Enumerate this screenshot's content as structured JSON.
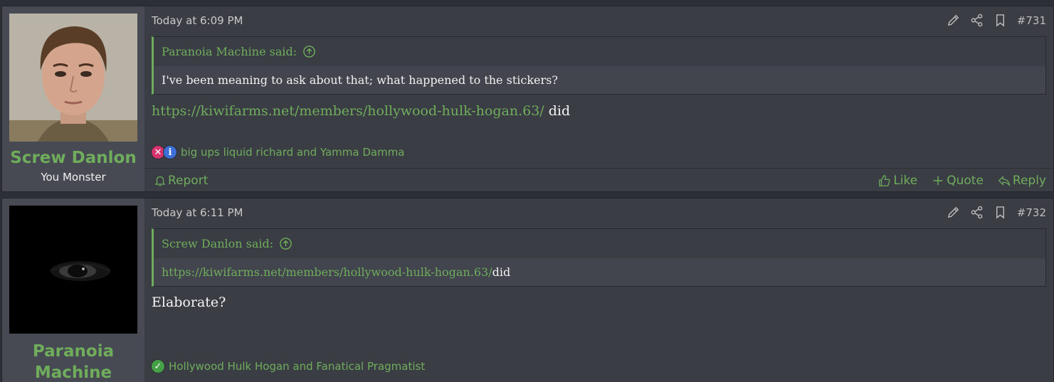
{
  "posts": [
    {
      "username": "Screw Danlon",
      "user_title": "You Monster",
      "avatar_icon": "user-photo-avatar",
      "date": "Today at 6:09 PM",
      "post_number": "#731",
      "quote": {
        "author": "Paranoia Machine said:",
        "text": "I've been meaning to ask about that; what happened to the stickers?"
      },
      "message": {
        "link": "https://kiwifarms.net/members/hollywood-hulk-hogan.63/",
        "suffix": " did"
      },
      "reactions": {
        "icons": [
          "x-reaction-icon",
          "info-reaction-icon"
        ],
        "names": "big ups liquid richard and Yamma Damma"
      },
      "footer": {
        "report": "Report",
        "like": "Like",
        "quote": "Quote",
        "reply": "Reply"
      }
    },
    {
      "username": "Paranoia Machine",
      "avatar_icon": "dark-eye-avatar",
      "date": "Today at 6:11 PM",
      "post_number": "#732",
      "quote": {
        "author": "Screw Danlon said:",
        "link": "https://kiwifarms.net/members/hollywood-hulk-hogan.63/",
        "suffix": " did"
      },
      "message": {
        "text": "Elaborate?"
      },
      "reactions": {
        "icons": [
          "check-reaction-icon"
        ],
        "names": "Hollywood Hulk Hogan and Fanatical Pragmatist"
      }
    }
  ],
  "colors": {
    "accent": "#6fad5c",
    "background": "#2c2f35",
    "post_bg": "#3a3d44",
    "user_cell_bg": "#474a52"
  }
}
